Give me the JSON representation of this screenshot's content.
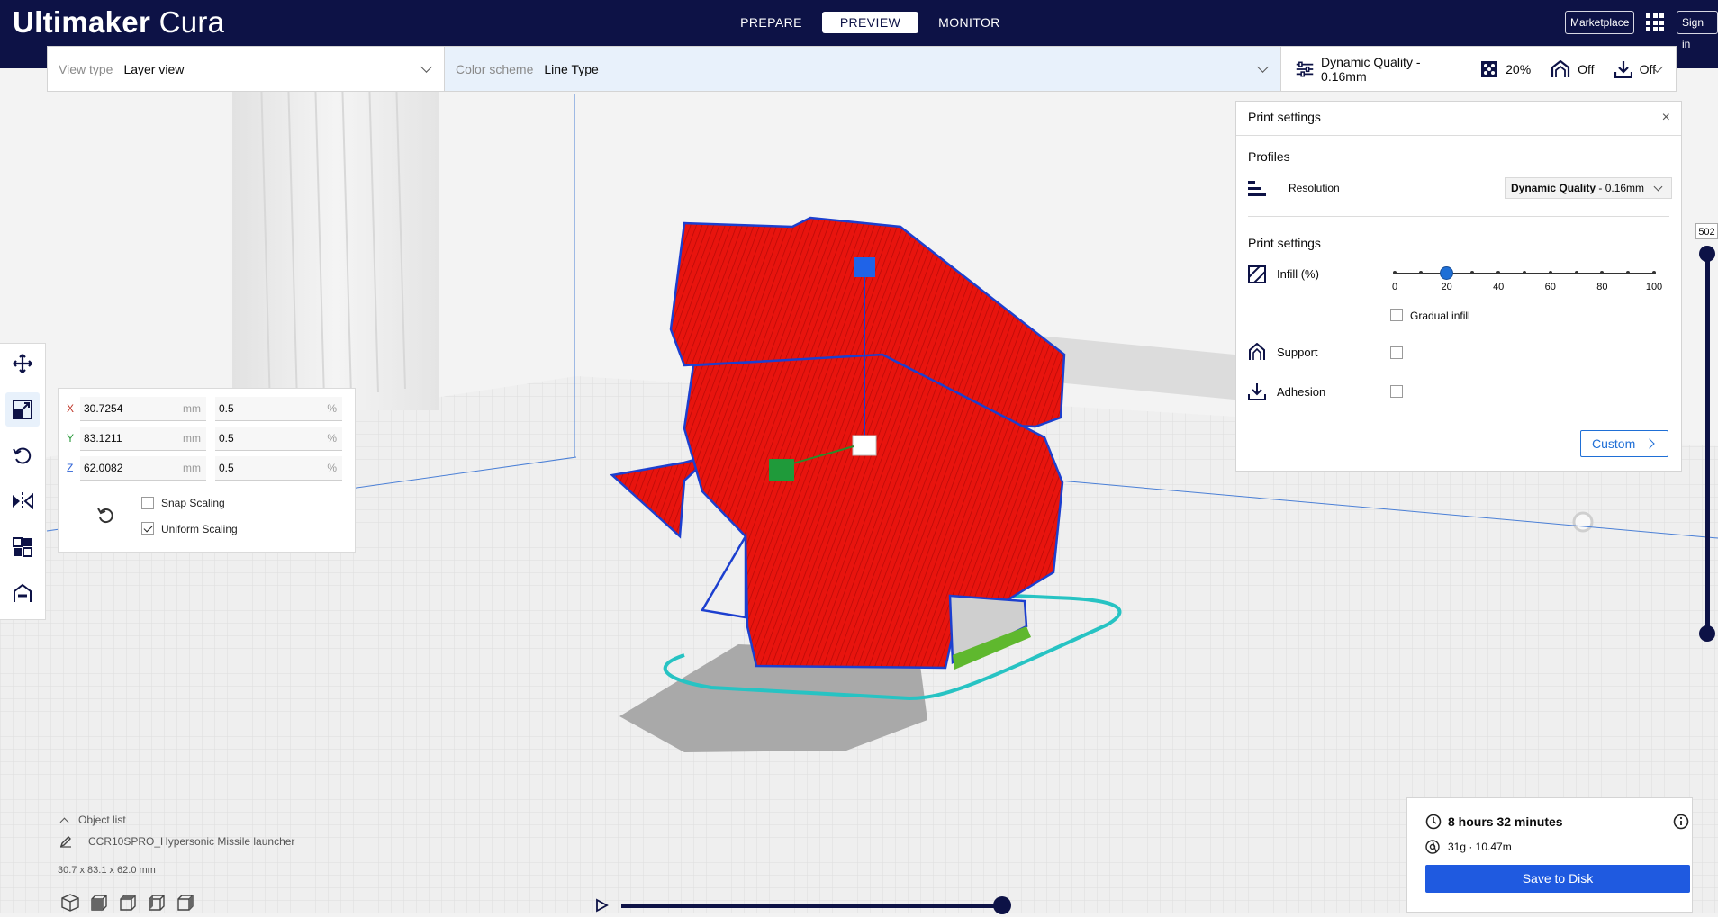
{
  "app": {
    "brand_bold": "Ultimaker",
    "brand_light": "Cura"
  },
  "stages": [
    "PREPARE",
    "PREVIEW",
    "MONITOR"
  ],
  "active_stage": "PREVIEW",
  "header": {
    "marketplace": "Marketplace",
    "sign_in": "Sign in"
  },
  "viewbar": {
    "view_type_label": "View type",
    "view_type_value": "Layer view",
    "color_scheme_label": "Color scheme",
    "color_scheme_value": "Line Type",
    "profile": "Dynamic Quality - 0.16mm",
    "infill": "20%",
    "support": "Off",
    "adhesion": "Off"
  },
  "scale_panel": {
    "x_axis": "X",
    "x_mm": "30.7254",
    "x_pct": "0.5",
    "y_axis": "Y",
    "y_mm": "83.1211",
    "y_pct": "0.5",
    "z_axis": "Z",
    "z_mm": "62.0082",
    "z_pct": "0.5",
    "unit_mm": "mm",
    "unit_pct": "%",
    "snap_scaling": "Snap Scaling",
    "snap_checked": false,
    "uniform_scaling": "Uniform Scaling",
    "uniform_checked": true
  },
  "print_settings": {
    "title": "Print settings",
    "close": "×",
    "profiles_heading": "Profiles",
    "resolution_label": "Resolution",
    "resolution_bold": "Dynamic Quality",
    "resolution_rest": " - 0.16mm",
    "settings_heading": "Print settings",
    "infill_label": "Infill (%)",
    "infill_value": 20,
    "infill_ticks": [
      "0",
      "20",
      "40",
      "60",
      "80",
      "100"
    ],
    "gradual_infill": "Gradual infill",
    "support_label": "Support",
    "adhesion_label": "Adhesion",
    "custom_button": "Custom"
  },
  "layer_slider": {
    "current_layer": "502"
  },
  "object_list": {
    "toggle": "Object list",
    "object_name": "CCR10SPRO_Hypersonic Missile launcher",
    "dimensions": "30.7 x 83.1 x 62.0 mm"
  },
  "action_panel": {
    "print_time": "8 hours 32 minutes",
    "material": "31g · 10.47m",
    "save_button": "Save to Disk"
  },
  "colors": {
    "header_bg": "#0d1246",
    "accent_blue": "#1f5ae0",
    "model_red": "#e8140e",
    "color_scheme_bg": "#e8f1fb"
  }
}
